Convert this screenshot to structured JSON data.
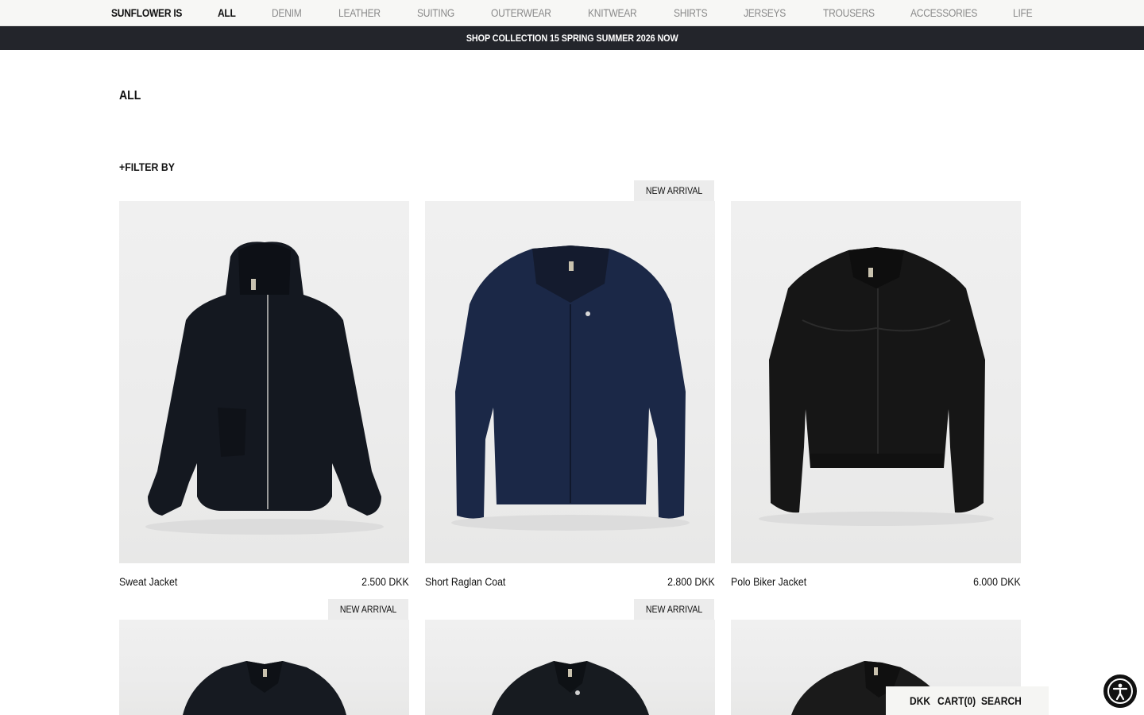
{
  "nav": {
    "brand": "SUNFLOWER IS",
    "items": [
      {
        "label": "ALL",
        "active": true
      },
      {
        "label": "DENIM"
      },
      {
        "label": "LEATHER"
      },
      {
        "label": "SUITING"
      },
      {
        "label": "OUTERWEAR"
      },
      {
        "label": "KNITWEAR"
      },
      {
        "label": "SHIRTS"
      },
      {
        "label": "JERSEYS"
      },
      {
        "label": "TROUSERS"
      },
      {
        "label": "ACCESSORIES"
      },
      {
        "label": "LIFE"
      }
    ]
  },
  "announcement": "SHOP COLLECTION 15 SPRING SUMMER 2026 NOW",
  "page": {
    "title": "ALL",
    "filter_label": "+FILTER BY"
  },
  "products": [
    {
      "name": "Sweat Jacket",
      "price": "2.500 DKK",
      "badge": "",
      "garment": "hooded-zip-jacket",
      "color": "#141820"
    },
    {
      "name": "Short Raglan Coat",
      "price": "2.800 DKK",
      "badge": "NEW ARRIVAL",
      "garment": "raglan-coat",
      "color": "#1b2847"
    },
    {
      "name": "Polo Biker Jacket",
      "price": "6.000 DKK",
      "badge": "",
      "garment": "leather-biker-jacket",
      "color": "#161616"
    },
    {
      "name": "",
      "price": "",
      "badge": "NEW ARRIVAL",
      "garment": "collared-jacket",
      "color": "#161a21"
    },
    {
      "name": "",
      "price": "",
      "badge": "NEW ARRIVAL",
      "garment": "collared-jacket",
      "color": "#171b20"
    },
    {
      "name": "",
      "price": "",
      "badge": "",
      "garment": "leather-jacket",
      "color": "#1a1a1a"
    }
  ],
  "bottom_bar": {
    "currency": "DKK",
    "cart": "CART(0)",
    "search": "SEARCH"
  },
  "accessibility_icon": "accessibility-icon"
}
